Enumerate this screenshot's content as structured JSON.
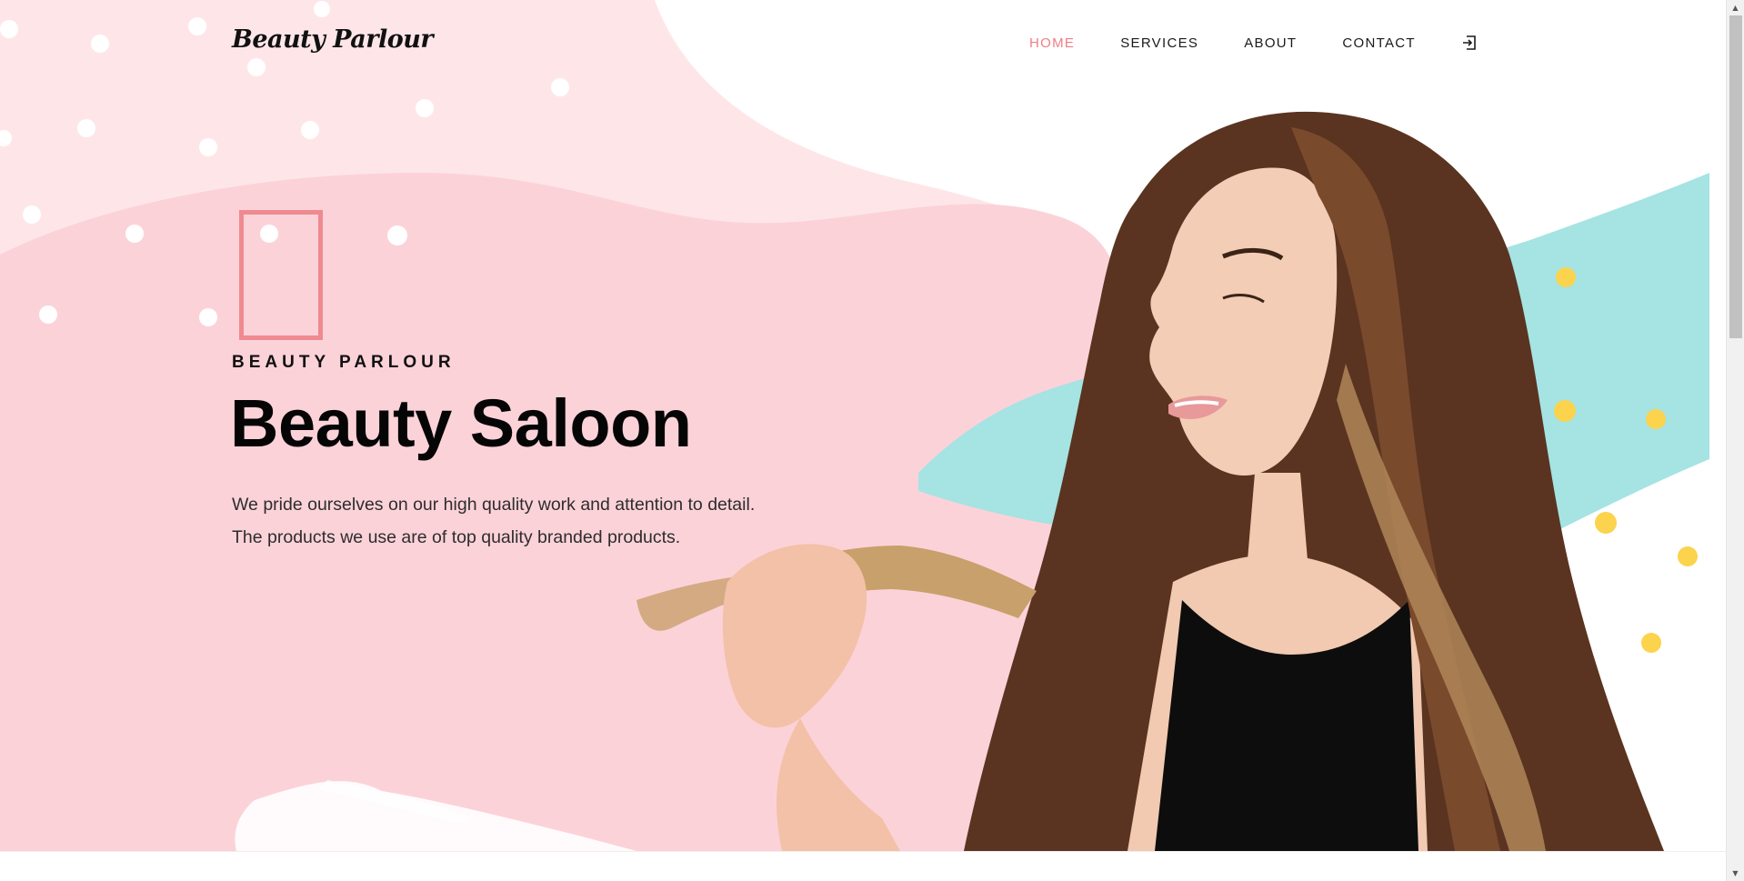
{
  "brand": {
    "logo_text": "Beauty Parlour"
  },
  "nav": {
    "items": [
      {
        "label": "HOME",
        "active": true
      },
      {
        "label": "SERVICES",
        "active": false
      },
      {
        "label": "ABOUT",
        "active": false
      },
      {
        "label": "CONTACT",
        "active": false
      }
    ],
    "login_icon": "login-icon"
  },
  "hero": {
    "eyebrow": "BEAUTY PARLOUR",
    "headline": "Beauty Saloon",
    "description": "We pride ourselves on our high quality work and attention to detail. The products we use are of top quality branded products.",
    "image_alt": "woman-with-long-hair-photo"
  },
  "colors": {
    "accent": "#ef7d85",
    "pink_blob": "#fcd2d9",
    "light_pink": "#fee6e8",
    "mint_stroke": "#a6e3e3",
    "yellow_dot": "#fbd34d"
  }
}
